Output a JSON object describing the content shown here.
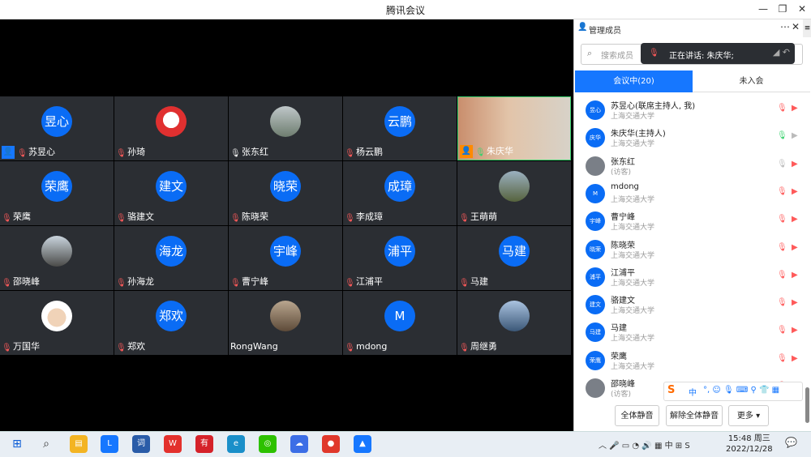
{
  "window": {
    "title": "腾讯会议"
  },
  "tiles": [
    {
      "name": "苏昱心",
      "avatar_text": "昱心",
      "mic": "muted",
      "host": true
    },
    {
      "name": "孙琦",
      "avatar_text": "",
      "photo": "cartoon",
      "mic": "muted"
    },
    {
      "name": "张东红",
      "avatar_text": "",
      "photo": "landscape",
      "mic": "on"
    },
    {
      "name": "杨云鹏",
      "avatar_text": "云鹏",
      "mic": "muted"
    },
    {
      "name": "朱庆华",
      "avatar_text": "",
      "photo": "video",
      "mic": "green",
      "host": true,
      "active": true
    },
    {
      "name": "荣鹰",
      "avatar_text": "荣鹰",
      "mic": "muted"
    },
    {
      "name": "骆建文",
      "avatar_text": "建文",
      "mic": "muted"
    },
    {
      "name": "陈晓荣",
      "avatar_text": "晓荣",
      "mic": "muted"
    },
    {
      "name": "李成璋",
      "avatar_text": "成璋",
      "mic": "muted"
    },
    {
      "name": "王萌萌",
      "avatar_text": "",
      "photo": "outdoor",
      "mic": "muted"
    },
    {
      "name": "邵晓峰",
      "avatar_text": "",
      "photo": "tree",
      "mic": "muted"
    },
    {
      "name": "孙海龙",
      "avatar_text": "海龙",
      "mic": "muted"
    },
    {
      "name": "曹宁峰",
      "avatar_text": "宇峰",
      "mic": "muted"
    },
    {
      "name": "江浦平",
      "avatar_text": "浦平",
      "mic": "muted"
    },
    {
      "name": "马建",
      "avatar_text": "马建",
      "mic": "muted"
    },
    {
      "name": "万国华",
      "avatar_text": "",
      "photo": "person",
      "mic": "muted"
    },
    {
      "name": "郑欢",
      "avatar_text": "郑欢",
      "mic": "muted"
    },
    {
      "name": "RongWang",
      "avatar_text": "",
      "photo": "building",
      "mic": "none"
    },
    {
      "name": "mdong",
      "avatar_text": "M",
      "mic": "muted"
    },
    {
      "name": "周继勇",
      "avatar_text": "",
      "photo": "sea",
      "mic": "muted"
    }
  ],
  "side": {
    "title": "管理成员",
    "search_placeholder": "搜索成员",
    "speaking_toast": "正在讲话: 朱庆华;",
    "tab_in": "会议中(20)",
    "tab_out": "未入会",
    "members": [
      {
        "avatar": "昱心",
        "name": "苏昱心(联席主持人, 我)",
        "sub": "上海交通大学",
        "mic": "muted",
        "cam": "off"
      },
      {
        "avatar": "庆华",
        "name": "朱庆华(主持人)",
        "sub": "上海交通大学",
        "mic": "on",
        "cam": "on"
      },
      {
        "avatar": "",
        "name": "张东红",
        "sub": "(访客)",
        "mic": "gray",
        "cam": "off",
        "gray": true
      },
      {
        "avatar": "M",
        "name": "mdong",
        "sub": "上海交通大学",
        "mic": "muted",
        "cam": "off"
      },
      {
        "avatar": "宇峰",
        "name": "曹宁峰",
        "sub": "上海交通大学",
        "mic": "muted",
        "cam": "off"
      },
      {
        "avatar": "晓荣",
        "name": "陈晓荣",
        "sub": "上海交通大学",
        "mic": "muted",
        "cam": "off"
      },
      {
        "avatar": "浦平",
        "name": "江浦平",
        "sub": "上海交通大学",
        "mic": "muted",
        "cam": "off"
      },
      {
        "avatar": "建文",
        "name": "骆建文",
        "sub": "上海交通大学",
        "mic": "muted",
        "cam": "off"
      },
      {
        "avatar": "马建",
        "name": "马建",
        "sub": "上海交通大学",
        "mic": "muted",
        "cam": "off"
      },
      {
        "avatar": "荣鹰",
        "name": "荣鹰",
        "sub": "上海交通大学",
        "mic": "muted",
        "cam": "off"
      },
      {
        "avatar": "",
        "name": "邵晓峰",
        "sub": "(访客)",
        "mic": "muted",
        "cam": "off",
        "gray": true
      }
    ],
    "btn_mute_all": "全体静音",
    "btn_unmute_all": "解除全体静音",
    "btn_more": "更多"
  },
  "taskbar": {
    "time": "15:48 周三",
    "date": "2022/12/28",
    "ime_lang": "中"
  },
  "colors": {
    "accent": "#1677ff",
    "tile_bg": "#2b2e33",
    "muted": "#ff5a5a"
  }
}
